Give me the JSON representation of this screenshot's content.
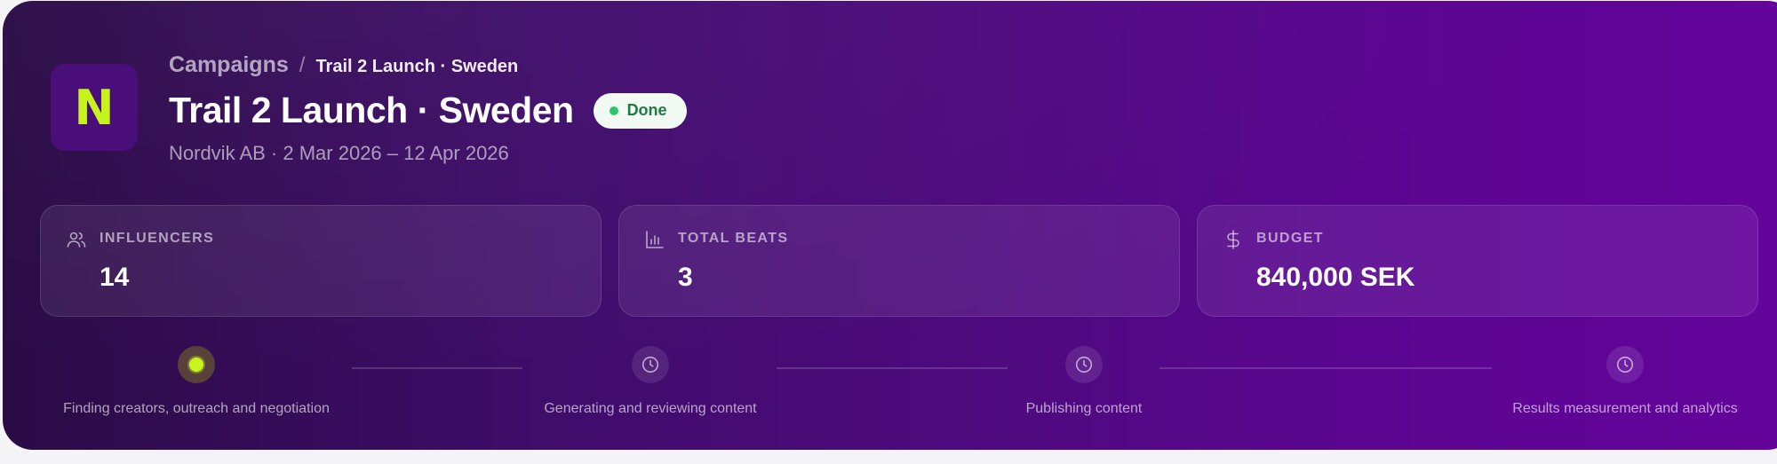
{
  "brand": {
    "logo_letter": "N",
    "logo_color": "#c6f31e",
    "card_gradient": [
      "#2a0b45",
      "#64049c"
    ]
  },
  "breadcrumb": {
    "root": "Campaigns",
    "separator": "/",
    "current": "Trail 2 Launch · Sweden"
  },
  "header": {
    "title": "Trail 2 Launch · Sweden",
    "status": "Done",
    "status_color": "#2fc56a",
    "subtitle": "Nordvik AB · 2 Mar 2026 – 12 Apr 2026"
  },
  "stats": [
    {
      "icon": "users-icon",
      "label": "INFLUENCERS",
      "value": "14"
    },
    {
      "icon": "bar-chart-icon",
      "label": "TOTAL BEATS",
      "value": "3"
    },
    {
      "icon": "dollar-icon",
      "label": "BUDGET",
      "value": "840,000 SEK"
    }
  ],
  "steps": [
    {
      "label": "Finding creators, outreach and negotiation",
      "state": "active",
      "icon": "active-dot-icon"
    },
    {
      "label": "Generating and reviewing content",
      "state": "pending",
      "icon": "clock-icon"
    },
    {
      "label": "Publishing content",
      "state": "pending",
      "icon": "clock-icon"
    },
    {
      "label": "Results measurement and analytics",
      "state": "pending",
      "icon": "clock-icon"
    }
  ]
}
